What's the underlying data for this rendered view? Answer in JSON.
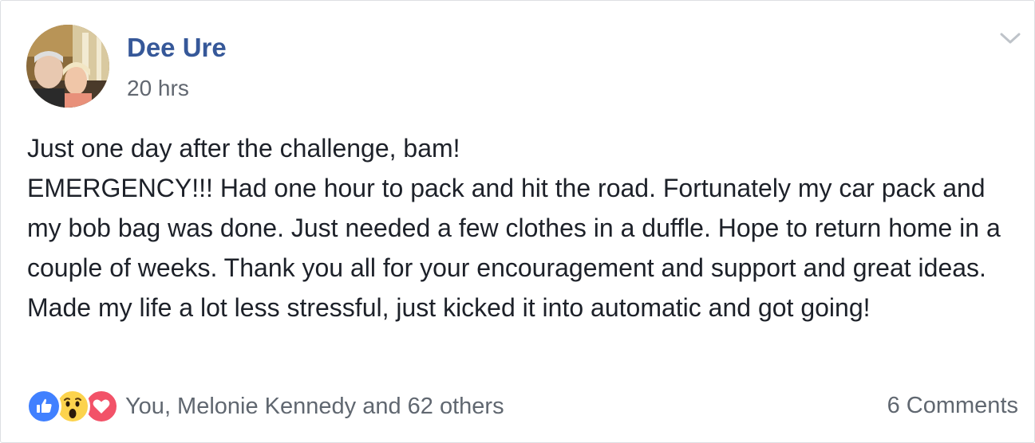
{
  "post": {
    "author": "Dee Ure",
    "timestamp": "20 hrs",
    "menu_icon": "chevron-down-icon",
    "body_lines": [
      "Just one day after the challenge, bam!",
      "EMERGENCY!!! Had one hour to pack and hit the road. Fortunately my car pack and my bob bag was done. Just needed a few clothes in a duffle. Hope to return home in a couple of weeks. Thank you all for your encouragement and support and great ideas. Made my life a lot less stressful, just kicked it into automatic and got going!"
    ]
  },
  "footer": {
    "reaction_icons": [
      "like-icon",
      "wow-icon",
      "love-icon"
    ],
    "reaction_summary": "You, Melonie Kennedy and 62 others",
    "comments": "6 Comments"
  },
  "colors": {
    "author_link": "#365899",
    "secondary_text": "#616770",
    "body_text": "#1d2129",
    "like_blue": "#4080ff",
    "wow_yellow": "#fcd34d",
    "love_red": "#f25268"
  }
}
